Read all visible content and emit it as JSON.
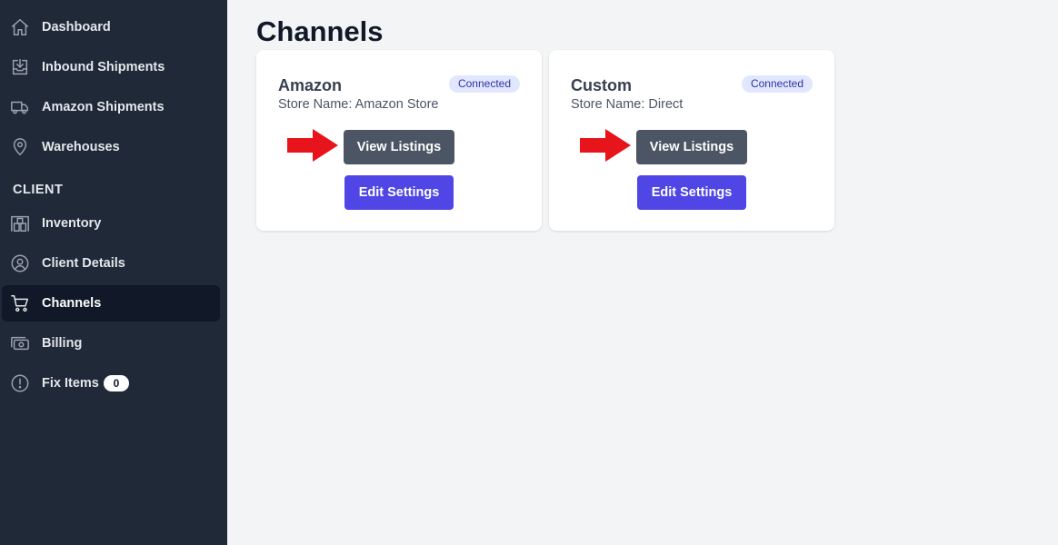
{
  "sidebar": {
    "items_top": [
      {
        "label": "Dashboard",
        "icon": "home-icon"
      },
      {
        "label": "Inbound Shipments",
        "icon": "inbox-download-icon"
      },
      {
        "label": "Amazon Shipments",
        "icon": "truck-icon"
      },
      {
        "label": "Warehouses",
        "icon": "location-pin-icon"
      }
    ],
    "section_label": "CLIENT",
    "items_client": [
      {
        "label": "Inventory",
        "icon": "warehouse-shelves-icon"
      },
      {
        "label": "Client Details",
        "icon": "user-circle-icon"
      },
      {
        "label": "Channels",
        "icon": "shopping-cart-icon",
        "active": true
      },
      {
        "label": "Billing",
        "icon": "cash-icon"
      },
      {
        "label": "Fix Items",
        "icon": "exclamation-circle-icon",
        "badge": "0"
      }
    ]
  },
  "page": {
    "title": "Channels"
  },
  "channels": [
    {
      "name": "Amazon",
      "store": "Store Name: Amazon Store",
      "status": "Connected",
      "view_label": "View Listings",
      "edit_label": "Edit Settings"
    },
    {
      "name": "Custom",
      "store": "Store Name: Direct",
      "status": "Connected",
      "view_label": "View Listings",
      "edit_label": "Edit Settings"
    }
  ],
  "colors": {
    "sidebar_bg": "#1f2937",
    "active_item_bg": "#111827",
    "view_button": "#4b5563",
    "edit_button": "#4f46e5",
    "badge_bg": "#e0e7ff",
    "badge_text": "#3730a3",
    "annotation_arrow": "#e8141b"
  }
}
